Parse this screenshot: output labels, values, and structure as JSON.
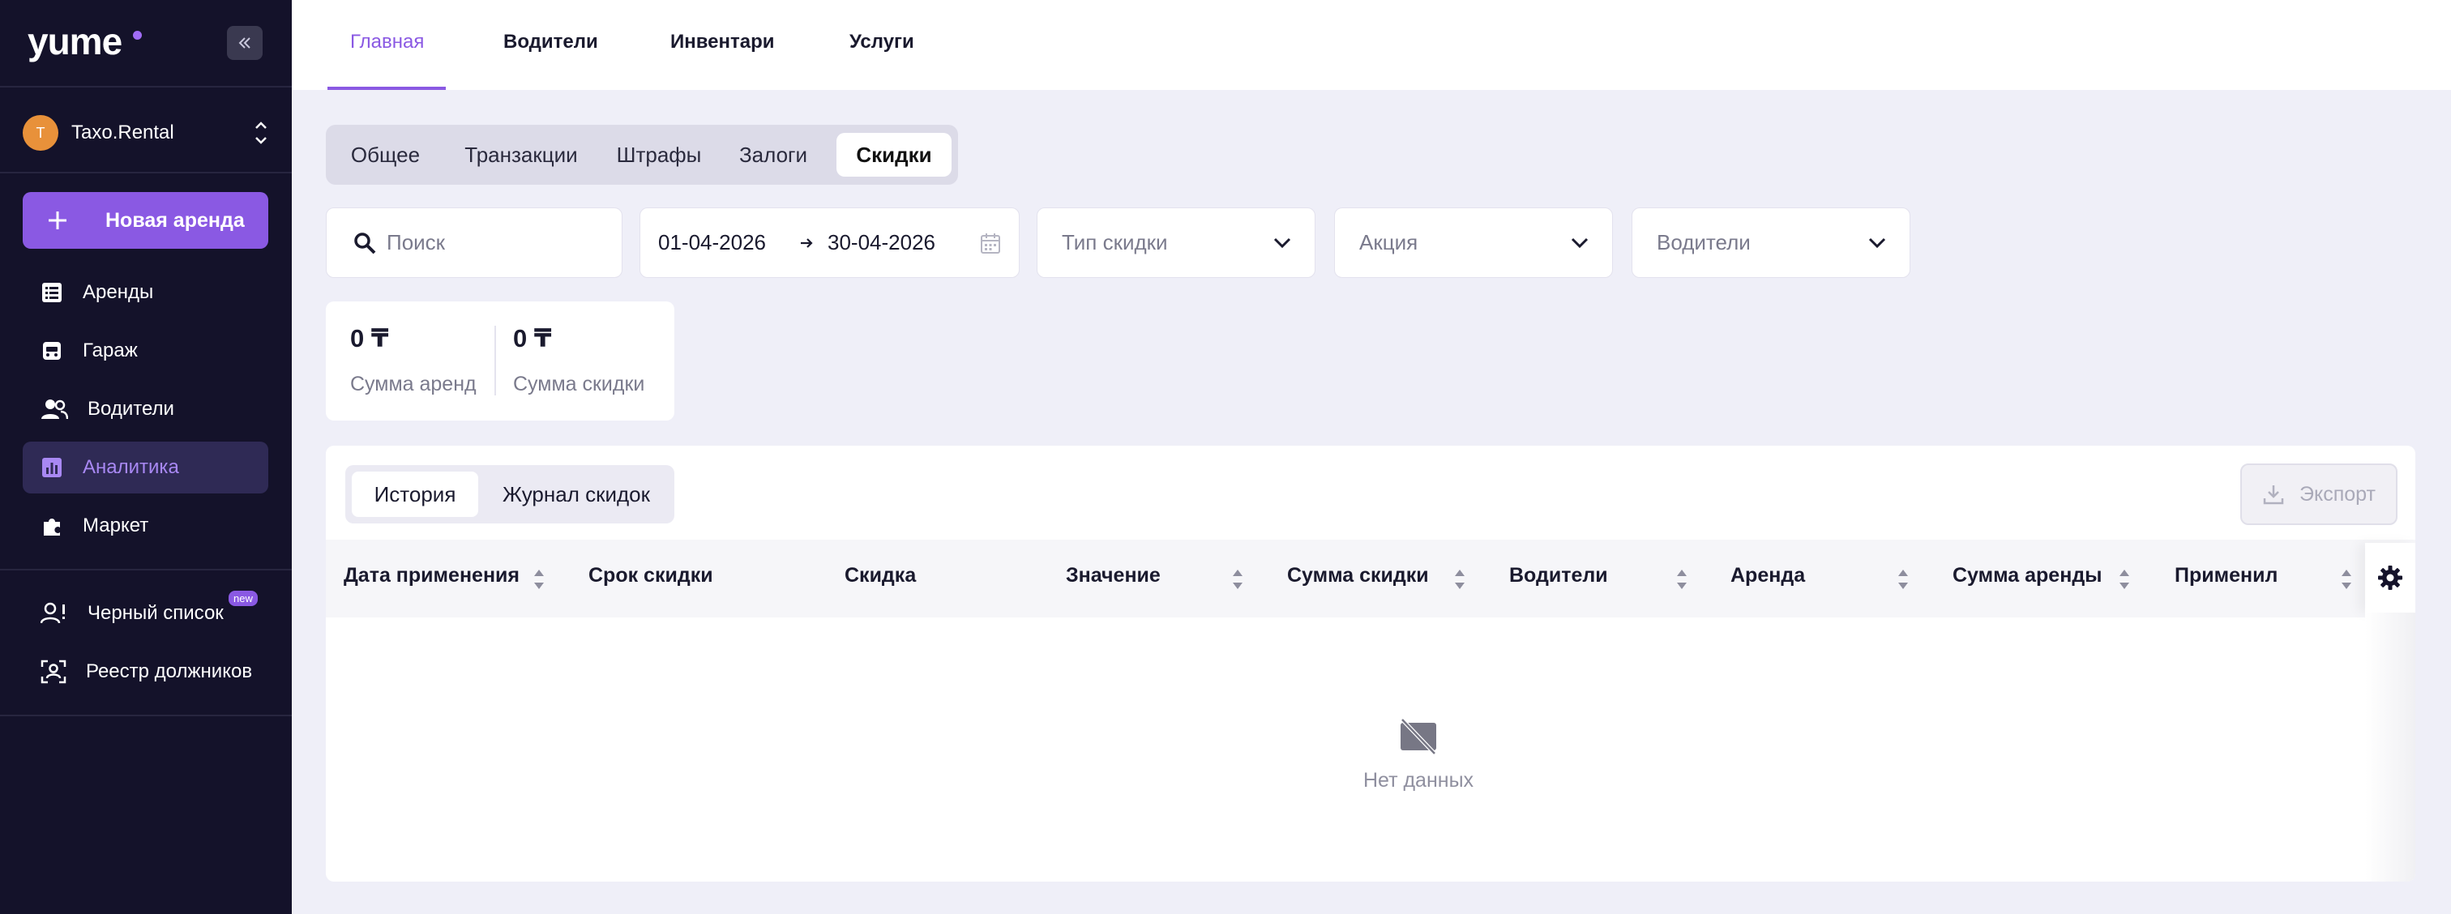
{
  "brand": {
    "logo": "yume",
    "accent": "#8a59e3"
  },
  "org": {
    "initial": "T",
    "name": "Taxo.Rental"
  },
  "sidebar": {
    "new_rent": "Новая аренда",
    "items": [
      {
        "label": "Аренды",
        "icon": "list-icon"
      },
      {
        "label": "Гараж",
        "icon": "car-icon"
      },
      {
        "label": "Водители",
        "icon": "users-icon"
      },
      {
        "label": "Аналитика",
        "icon": "chart-icon",
        "active": true
      },
      {
        "label": "Маркет",
        "icon": "puzzle-icon"
      }
    ],
    "secondary": [
      {
        "label": "Черный список",
        "badge": "new",
        "icon": "user-block-icon"
      },
      {
        "label": "Реестр должников",
        "icon": "user-scan-icon"
      }
    ]
  },
  "top_tabs": [
    "Главная",
    "Водители",
    "Инвентари",
    "Услуги"
  ],
  "section_tabs": [
    "Общее",
    "Транзакции",
    "Штрафы",
    "Залоги",
    "Скидки"
  ],
  "filters": {
    "search_placeholder": "Поиск",
    "date_from": "01-04-2026",
    "date_to": "30-04-2026",
    "discount_type": "Тип скидки",
    "promo": "Акция",
    "drivers": "Водители"
  },
  "stats": [
    {
      "value": "0 ₸",
      "label": "Сумма аренд"
    },
    {
      "value": "0 ₸",
      "label": "Сумма скидки"
    }
  ],
  "table": {
    "tabs": [
      "История",
      "Журнал скидок"
    ],
    "export": "Экспорт",
    "columns": [
      "Дата применения",
      "Срок скидки",
      "Скидка",
      "Значение",
      "Сумма скидки",
      "Водители",
      "Аренда",
      "Сумма аренды",
      "Применил"
    ],
    "empty": "Нет данных"
  }
}
